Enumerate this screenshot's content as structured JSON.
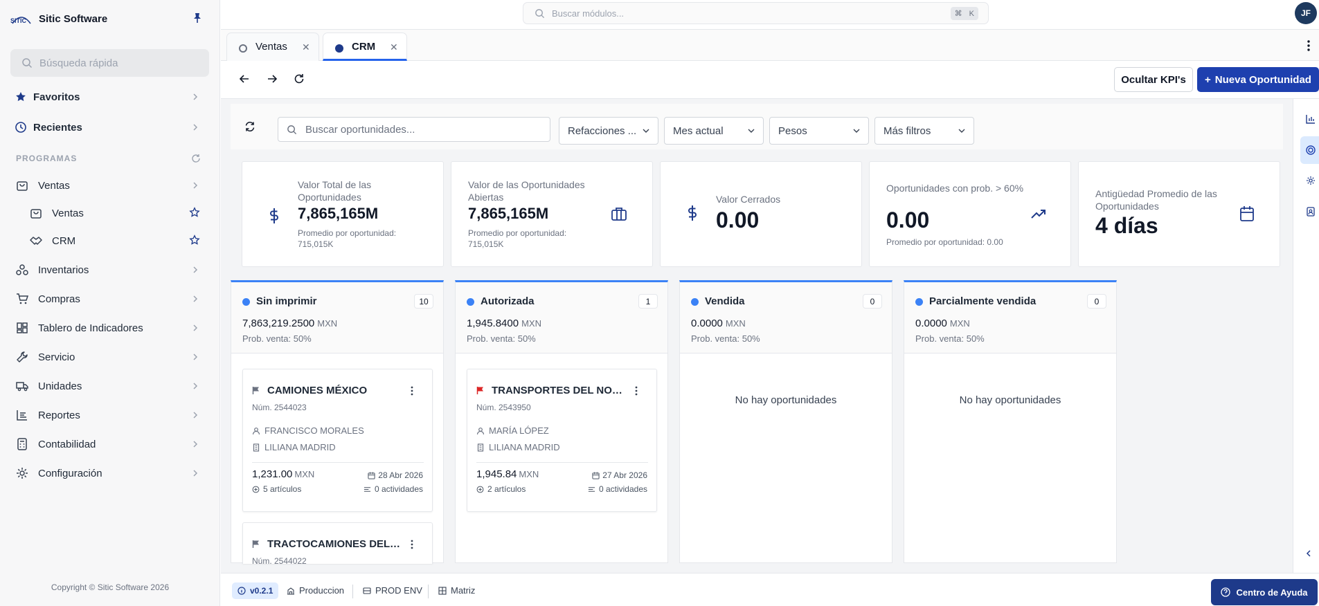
{
  "app": {
    "brand_name": "Sitic Software",
    "brand_logo_text": "SITIC",
    "user_initials": "JF"
  },
  "sidebar": {
    "quick_search_placeholder": "Búsqueda rápida",
    "favorites_label": "Favoritos",
    "recents_label": "Recientes",
    "section_label": "PROGRAMAS",
    "items": [
      {
        "label": "Ventas"
      },
      {
        "label": "Ventas"
      },
      {
        "label": "CRM"
      },
      {
        "label": "Inventarios"
      },
      {
        "label": "Compras"
      },
      {
        "label": "Tablero de Indicadores"
      },
      {
        "label": "Servicio"
      },
      {
        "label": "Unidades"
      },
      {
        "label": "Reportes"
      },
      {
        "label": "Contabilidad"
      },
      {
        "label": "Configuración"
      }
    ],
    "copyright": "Copyright © Sitic Software 2026"
  },
  "topbar": {
    "search_placeholder": "Buscar módulos...",
    "shortcut_mod": "⌘",
    "shortcut_key": "K"
  },
  "tabs": [
    {
      "label": "Ventas",
      "active": false
    },
    {
      "label": "CRM",
      "active": true
    }
  ],
  "toolbar": {
    "hide_kpis_label": "Ocultar KPI's",
    "new_opportunity_label": "Nueva Oportunidad"
  },
  "filters": {
    "search_placeholder": "Buscar oportunidades...",
    "branch_value": "Refacciones ...",
    "period_value": "Mes actual",
    "currency_value": "Pesos",
    "more_filters_label": "Más filtros"
  },
  "kpis": [
    {
      "title": "Valor Total de las Oportunidades",
      "value": "7,865,165M",
      "sub": "Promedio por oportunidad: 715,015K",
      "icon": "dollar-icon"
    },
    {
      "title": "Valor de las Oportunidades Abiertas",
      "value": "7,865,165M",
      "sub": "Promedio por oportunidad: 715,015K",
      "icon": "briefcase-icon"
    },
    {
      "title": "Valor Cerrados",
      "value": "0.00",
      "sub": "",
      "icon": "dollar-icon"
    },
    {
      "title": "Oportunidades con prob. > 60%",
      "value": "0.00",
      "sub": "Promedio por oportunidad: 0.00",
      "icon": "trending-up-icon"
    },
    {
      "title": "Antigüedad Promedio de las Oportunidades",
      "value": "4 días",
      "sub": "",
      "icon": "calendar-icon"
    }
  ],
  "columns": [
    {
      "title": "Sin imprimir",
      "count": "10",
      "amount": "7,863,219.2500",
      "currency": "MXN",
      "prob": "Prob. venta: 50%",
      "cards": [
        {
          "name": "CAMIONES MÉXICO",
          "number": "Núm. 2544023",
          "contact": "FRANCISCO MORALES",
          "company": "LILIANA MADRID",
          "amount": "1,231.00",
          "currency": "MXN",
          "date": "28 Abr 2026",
          "articles": "5 artículos",
          "activities": "0 actividades",
          "flag_color": "#6b7280"
        },
        {
          "name": "TRACTOCAMIONES DEL S...",
          "number": "Núm. 2544022",
          "flag_color": "#6b7280"
        }
      ]
    },
    {
      "title": "Autorizada",
      "count": "1",
      "amount": "1,945.8400",
      "currency": "MXN",
      "prob": "Prob. venta: 50%",
      "cards": [
        {
          "name": "TRANSPORTES DEL NORTE",
          "number": "Núm. 2543950",
          "contact": "MARÍA LÓPEZ",
          "company": "LILIANA MADRID",
          "amount": "1,945.84",
          "currency": "MXN",
          "date": "27 Abr 2026",
          "articles": "2 artículos",
          "activities": "0 actividades",
          "flag_color": "#dc2626"
        }
      ]
    },
    {
      "title": "Vendida",
      "count": "0",
      "amount": "0.0000",
      "currency": "MXN",
      "prob": "Prob. venta: 50%",
      "empty": "No hay oportunidades"
    },
    {
      "title": "Parcialmente vendida",
      "count": "0",
      "amount": "0.0000",
      "currency": "MXN",
      "prob": "Prob. venta: 50%",
      "empty": "No hay oportunidades"
    }
  ],
  "footer": {
    "version": "v0.2.1",
    "environment": "Produccion",
    "env_code": "PROD ENV",
    "branch": "Matriz",
    "help_label": "Centro de Ayuda"
  },
  "colors": {
    "primary": "#1e40af",
    "accent": "#3b82f6",
    "sidebar_bg": "#f7f7f8",
    "flag_red": "#dc2626"
  }
}
